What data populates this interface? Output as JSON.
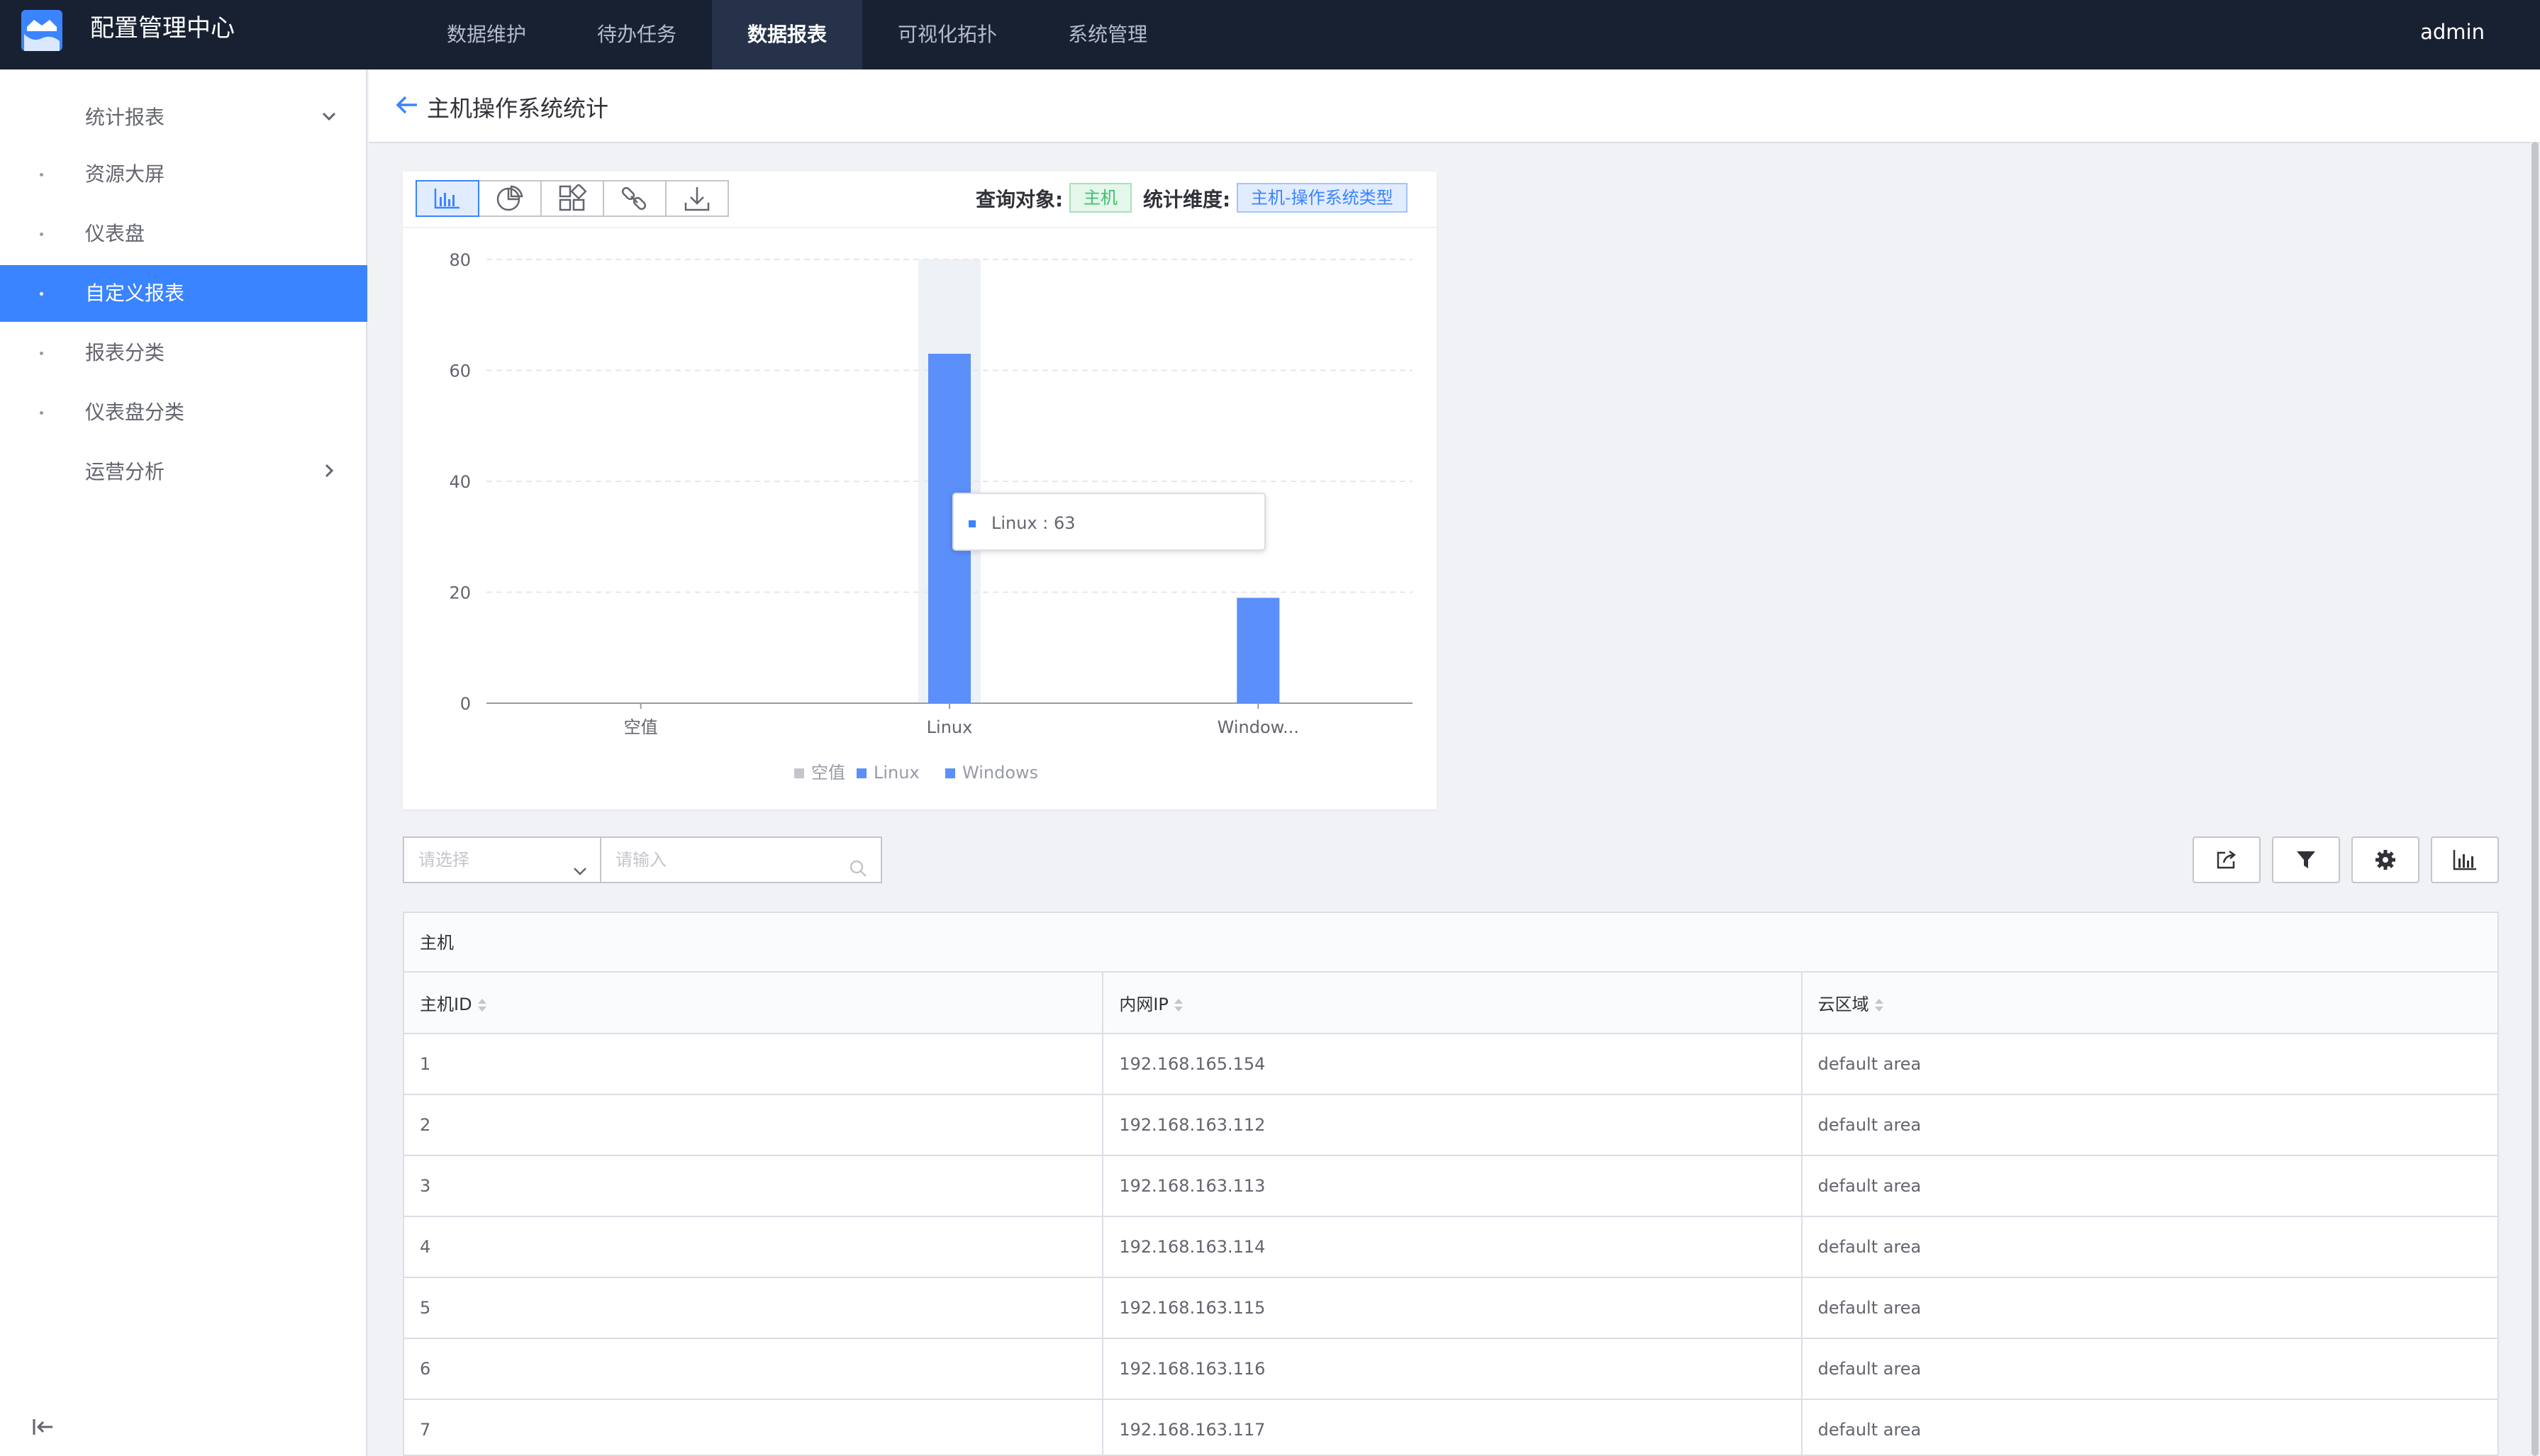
{
  "app": {
    "title": "配置管理中心",
    "user": "admin"
  },
  "nav": [
    {
      "label": "数据维护"
    },
    {
      "label": "待办任务"
    },
    {
      "label": "数据报表"
    },
    {
      "label": "可视化拓扑"
    },
    {
      "label": "系统管理"
    }
  ],
  "nav_active": "数据报表",
  "sidebar": {
    "group1": "统计报表",
    "items": [
      "资源大屏",
      "仪表盘",
      "自定义报表",
      "报表分类",
      "仪表盘分类"
    ],
    "active": "自定义报表",
    "group2": "运营分析"
  },
  "page": {
    "title": "主机操作系统统计"
  },
  "chart_panel": {
    "query_object_label": "查询对象:",
    "query_object_value": "主机",
    "dimension_label": "统计维度:",
    "dimension_value": "主机-操作系统类型",
    "tooltip": "Linux : 63"
  },
  "chart_data": {
    "type": "bar",
    "categories": [
      "空值",
      "Linux",
      "Window..."
    ],
    "series": [
      {
        "name": "空值",
        "values": [
          0,
          null,
          null
        ]
      },
      {
        "name": "Linux",
        "values": [
          null,
          63,
          null
        ]
      },
      {
        "name": "Windows",
        "values": [
          null,
          null,
          19
        ]
      }
    ],
    "ylim": [
      0,
      80
    ],
    "yticks": [
      0,
      20,
      40,
      60,
      80
    ],
    "legend": [
      "空值",
      "Linux",
      "Windows"
    ],
    "legend_position": "bottom",
    "grid": true,
    "colors": {
      "空值": "#c4c6cc",
      "Linux": "#5b8ff9",
      "Windows": "#5b8ff9"
    }
  },
  "filter": {
    "select_placeholder": "请选择",
    "input_placeholder": "请输入"
  },
  "table": {
    "caption": "主机",
    "columns": [
      "主机ID",
      "内网IP",
      "云区域"
    ],
    "rows": [
      [
        "1",
        "192.168.165.154",
        "default area"
      ],
      [
        "2",
        "192.168.163.112",
        "default area"
      ],
      [
        "3",
        "192.168.163.113",
        "default area"
      ],
      [
        "4",
        "192.168.163.114",
        "default area"
      ],
      [
        "5",
        "192.168.163.115",
        "default area"
      ],
      [
        "6",
        "192.168.163.116",
        "default area"
      ],
      [
        "7",
        "192.168.163.117",
        "default area"
      ]
    ]
  },
  "colors": {
    "primary": "#3a84ff",
    "header_bg": "#182132",
    "bar": "#5b8ff9"
  }
}
